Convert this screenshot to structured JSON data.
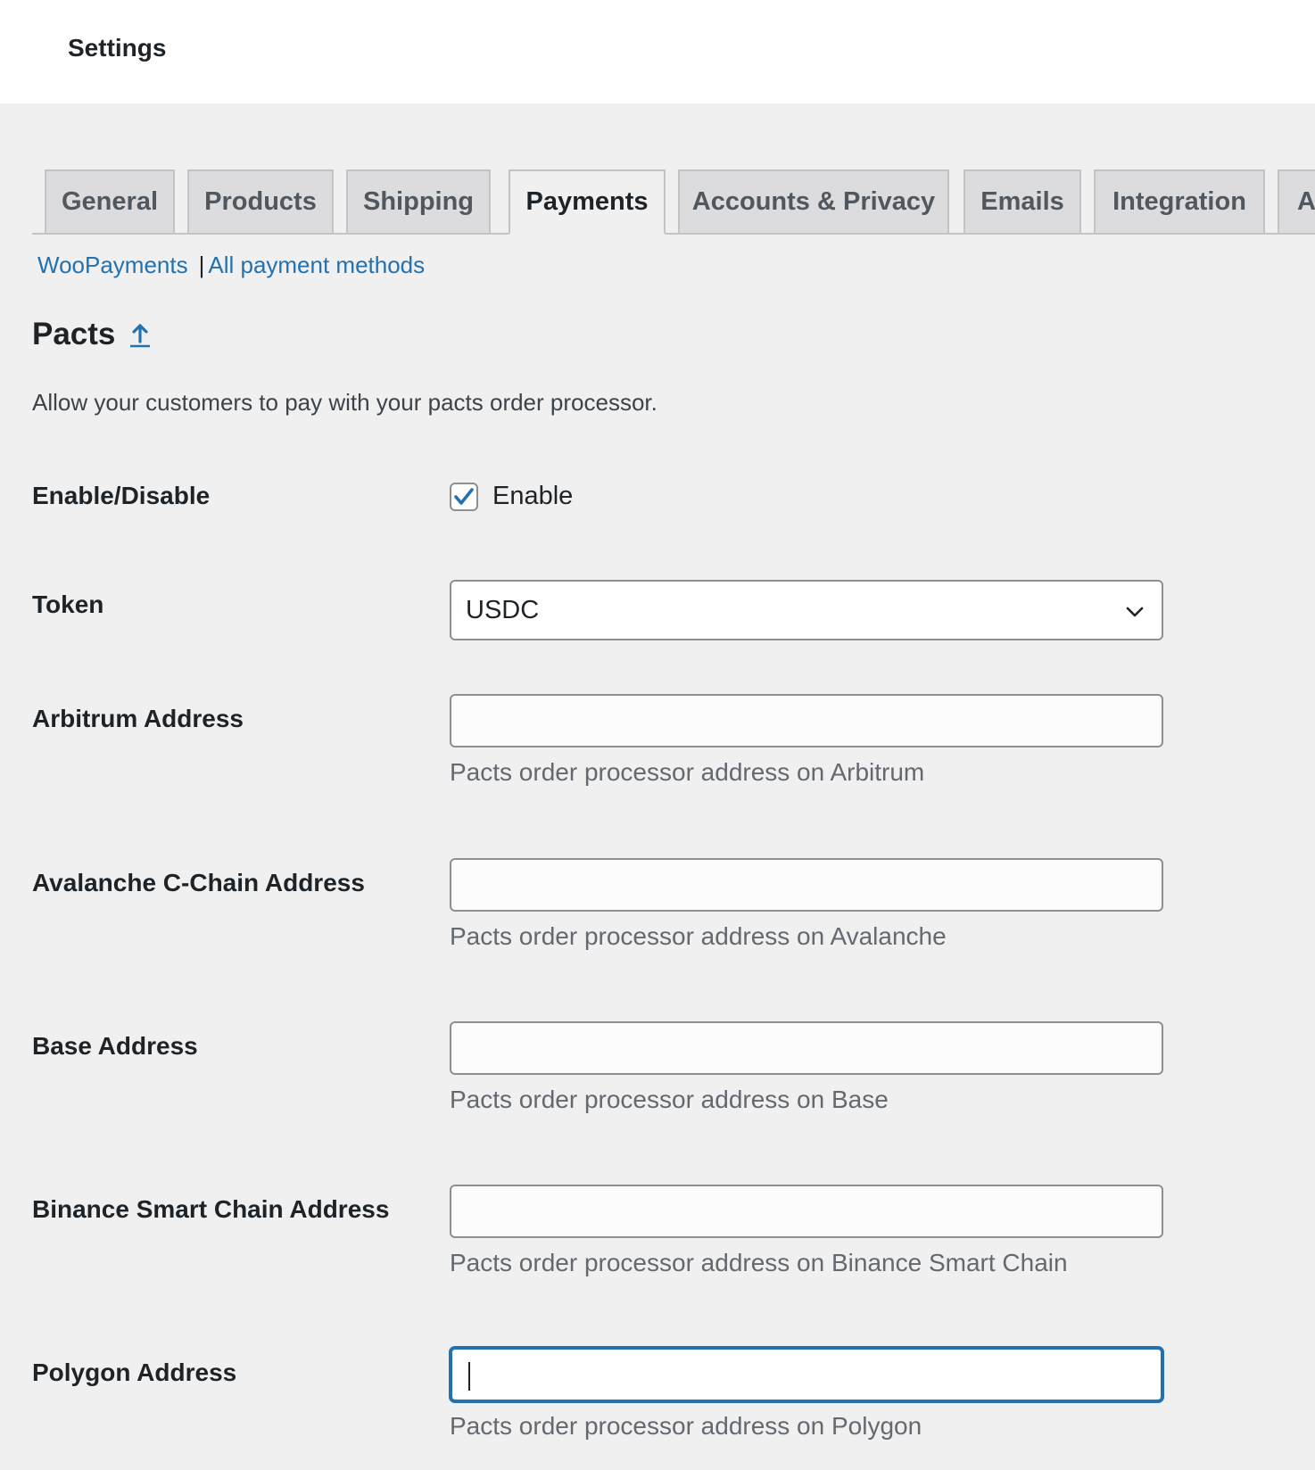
{
  "header": {
    "title": "Settings"
  },
  "tabs": [
    {
      "label": "General"
    },
    {
      "label": "Products"
    },
    {
      "label": "Shipping"
    },
    {
      "label": "Payments",
      "active": true
    },
    {
      "label": "Accounts & Privacy"
    },
    {
      "label": "Emails"
    },
    {
      "label": "Integration"
    },
    {
      "label": "A"
    }
  ],
  "subnav": {
    "link1": "WooPayments",
    "separator": "|",
    "link2": "All payment methods"
  },
  "section": {
    "title": "Pacts",
    "description": "Allow your customers to pay with your pacts order processor."
  },
  "fields": {
    "enable": {
      "label": "Enable/Disable",
      "checkbox_label": "Enable",
      "checked": true
    },
    "token": {
      "label": "Token",
      "value": "USDC"
    },
    "arbitrum": {
      "label": "Arbitrum Address",
      "value": "",
      "hint": "Pacts order processor address on Arbitrum"
    },
    "avalanche": {
      "label": "Avalanche C-Chain Address",
      "value": "",
      "hint": "Pacts order processor address on Avalanche"
    },
    "base": {
      "label": "Base Address",
      "value": "",
      "hint": "Pacts order processor address on Base"
    },
    "bsc": {
      "label": "Binance Smart Chain Address",
      "value": "",
      "hint": "Pacts order processor address on Binance Smart Chain"
    },
    "polygon": {
      "label": "Polygon Address",
      "value": "",
      "hint": "Pacts order processor address on Polygon",
      "focused": true
    }
  },
  "colors": {
    "accent": "#2271b1",
    "background": "#f0f0f1",
    "tab_bg": "#dcdcde"
  },
  "icons": {
    "section_link": "arrow-up-icon",
    "select": "chevron-down-icon",
    "checkbox": "checkmark-icon"
  }
}
